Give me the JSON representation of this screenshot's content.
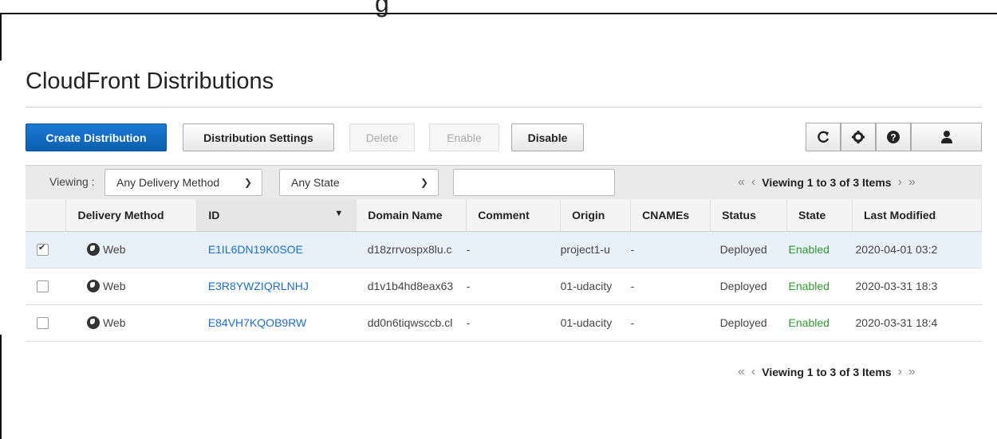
{
  "page": {
    "title": "CloudFront Distributions",
    "clipped_heading": "g"
  },
  "toolbar": {
    "create": "Create Distribution",
    "settings": "Distribution Settings",
    "delete": "Delete",
    "enable": "Enable",
    "disable": "Disable",
    "icons": [
      "refresh-icon",
      "gear-icon",
      "help-icon",
      "user-icon"
    ]
  },
  "filter": {
    "viewing_label": "Viewing :",
    "delivery_method": "Any Delivery Method",
    "state": "Any State",
    "search_value": "",
    "pager_text": "Viewing 1 to 3 of 3 Items"
  },
  "table": {
    "columns": [
      "Delivery Method",
      "ID",
      "Domain Name",
      "Comment",
      "Origin",
      "CNAMEs",
      "Status",
      "State",
      "Last Modified"
    ],
    "rows": [
      {
        "checked": true,
        "method": "Web",
        "id": "E1IL6DN19K0SOE",
        "domain": "d18zrrvospx8lu.c",
        "comment": "-",
        "origin": "project1-u",
        "cnames": "-",
        "status": "Deployed",
        "state": "Enabled",
        "modified": "2020-04-01 03:2"
      },
      {
        "checked": false,
        "method": "Web",
        "id": "E3R8YWZIQRLNHJ",
        "domain": "d1v1b4hd8eax63",
        "comment": "-",
        "origin": "01-udacity",
        "cnames": "-",
        "status": "Deployed",
        "state": "Enabled",
        "modified": "2020-03-31 18:3"
      },
      {
        "checked": false,
        "method": "Web",
        "id": "E84VH7KQOB9RW",
        "domain": "dd0n6tiqwsccb.cl",
        "comment": "-",
        "origin": "01-udacity",
        "cnames": "-",
        "status": "Deployed",
        "state": "Enabled",
        "modified": "2020-03-31 18:4"
      }
    ]
  },
  "footer": {
    "pager_text": "Viewing 1 to 3 of 3 Items"
  },
  "colors": {
    "primary": "#0b5fae",
    "link": "#1a6ec7",
    "enabled": "#2e9b2e",
    "selected_row": "#e8f1fa"
  }
}
